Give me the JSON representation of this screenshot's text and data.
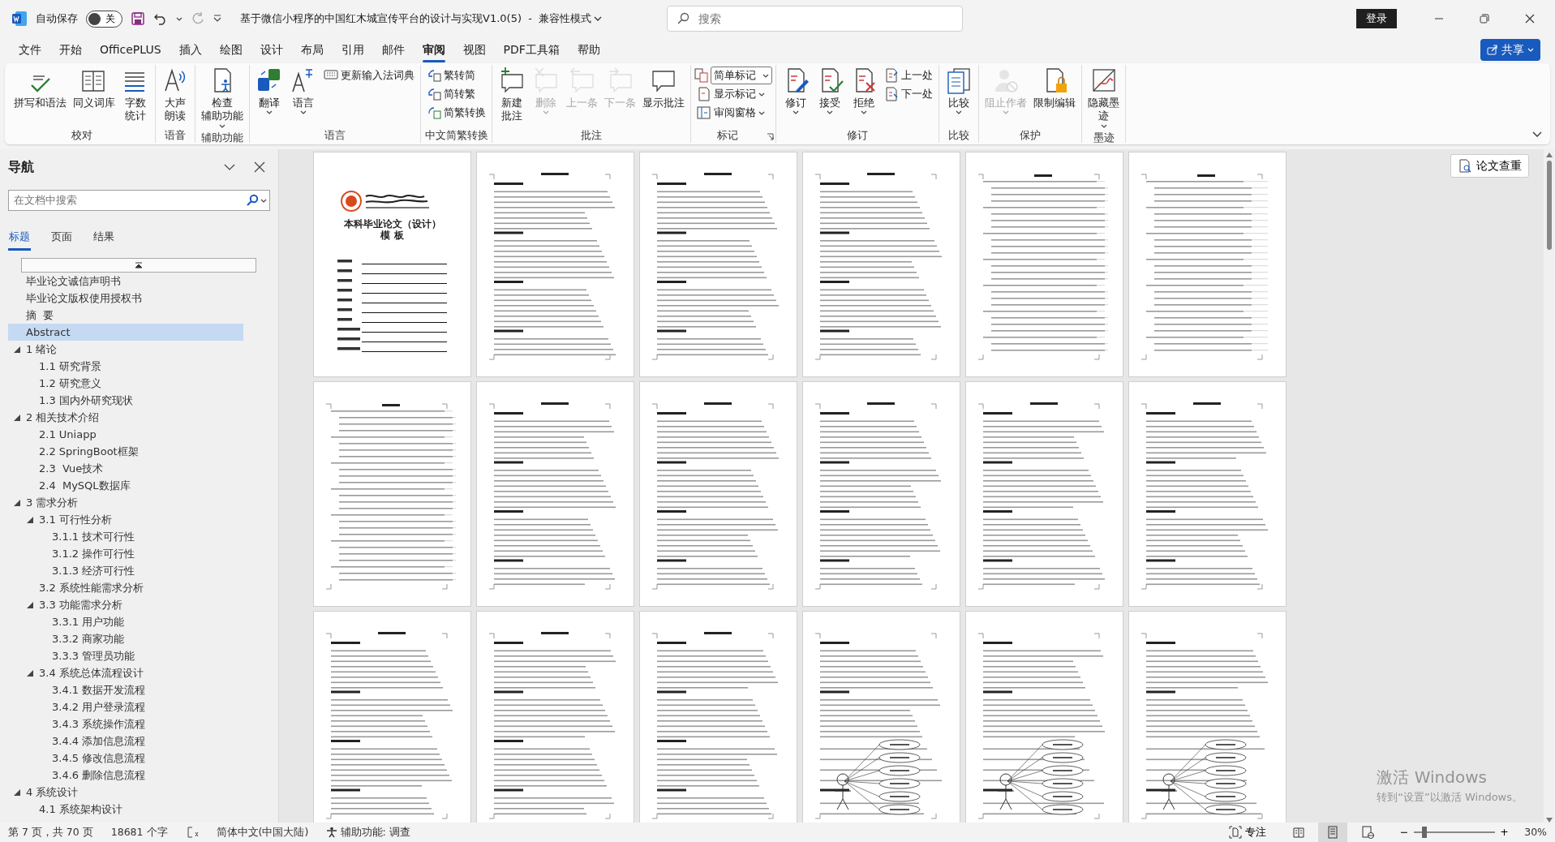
{
  "titlebar": {
    "autosave_label": "自动保存",
    "autosave_on": false,
    "autosave_state": "关",
    "title": "基于微信小程序的中国红木城宣传平台的设计与实现V1.0(5)  -  兼容性模式",
    "search_placeholder": "搜索",
    "login": "登录"
  },
  "menu_tabs": [
    {
      "label": "文件",
      "selected": false
    },
    {
      "label": "开始",
      "selected": false
    },
    {
      "label": "OfficePLUS",
      "selected": false
    },
    {
      "label": "插入",
      "selected": false
    },
    {
      "label": "绘图",
      "selected": false
    },
    {
      "label": "设计",
      "selected": false
    },
    {
      "label": "布局",
      "selected": false
    },
    {
      "label": "引用",
      "selected": false
    },
    {
      "label": "邮件",
      "selected": false
    },
    {
      "label": "审阅",
      "selected": true
    },
    {
      "label": "视图",
      "selected": false
    },
    {
      "label": "PDF工具箱",
      "selected": false
    },
    {
      "label": "帮助",
      "selected": false
    }
  ],
  "share": "共享",
  "ribbon_groups": [
    {
      "label": "校对",
      "launcher": false,
      "items": [
        {
          "kind": "large",
          "label": "拼写和语法",
          "caret": false,
          "disabled": false
        },
        {
          "kind": "large",
          "label": "同义词库",
          "caret": false,
          "disabled": false
        },
        {
          "kind": "large",
          "lines": [
            "字数",
            "统计"
          ],
          "caret": false,
          "disabled": false
        }
      ]
    },
    {
      "label": "语音",
      "launcher": false,
      "items": [
        {
          "kind": "large",
          "lines": [
            "大声",
            "朗读"
          ],
          "caret": false,
          "disabled": false
        }
      ]
    },
    {
      "label": "辅助功能",
      "launcher": false,
      "items": [
        {
          "kind": "large",
          "lines": [
            "检查",
            "辅助功能"
          ],
          "caret": true,
          "disabled": false
        }
      ]
    },
    {
      "label": "语言",
      "launcher": false,
      "items": [
        {
          "kind": "large",
          "label": "翻译",
          "caret": true,
          "disabled": false
        },
        {
          "kind": "large",
          "label": "语言",
          "caret": true,
          "disabled": false
        },
        {
          "kind": "small",
          "label": "更新输入法词典",
          "caret": false,
          "disabled": false
        }
      ]
    },
    {
      "label": "中文简繁转换",
      "launcher": false,
      "items": [
        {
          "kind": "small",
          "label": "繁转简",
          "caret": false,
          "disabled": false
        },
        {
          "kind": "small",
          "label": "简转繁",
          "caret": false,
          "disabled": false
        },
        {
          "kind": "small",
          "label": "简繁转换",
          "caret": false,
          "disabled": false
        }
      ]
    },
    {
      "label": "批注",
      "launcher": false,
      "items": [
        {
          "kind": "large",
          "lines": [
            "新建",
            "批注"
          ],
          "caret": false,
          "disabled": false
        },
        {
          "kind": "large",
          "label": "删除",
          "caret": true,
          "disabled": true
        },
        {
          "kind": "large",
          "label": "上一条",
          "caret": false,
          "disabled": true
        },
        {
          "kind": "large",
          "label": "下一条",
          "caret": false,
          "disabled": true
        },
        {
          "kind": "large",
          "label": "显示批注",
          "caret": false,
          "disabled": false
        }
      ]
    },
    {
      "label": "标记",
      "launcher": true,
      "items": [
        {
          "kind": "select",
          "label": "简单标记",
          "caret": true,
          "disabled": false
        },
        {
          "kind": "small",
          "label": "显示标记",
          "caret": true,
          "disabled": false
        },
        {
          "kind": "small",
          "label": "审阅窗格",
          "caret": true,
          "disabled": false
        }
      ]
    },
    {
      "label": "修订",
      "launcher": false,
      "items": [
        {
          "kind": "large",
          "label": "修订",
          "caret": true,
          "disabled": false
        },
        {
          "kind": "large",
          "label": "接受",
          "caret": true,
          "disabled": false
        },
        {
          "kind": "large",
          "label": "拒绝",
          "caret": true,
          "disabled": false
        },
        {
          "kind": "small",
          "label": "上一处",
          "caret": false,
          "disabled": false
        },
        {
          "kind": "small",
          "label": "下一处",
          "caret": false,
          "disabled": false
        }
      ]
    },
    {
      "label": "比较",
      "launcher": false,
      "items": [
        {
          "kind": "large",
          "label": "比较",
          "caret": true,
          "disabled": false
        }
      ]
    },
    {
      "label": "保护",
      "launcher": false,
      "items": [
        {
          "kind": "large",
          "label": "阻止作者",
          "caret": true,
          "disabled": true
        },
        {
          "kind": "large",
          "label": "限制编辑",
          "caret": false,
          "disabled": false
        }
      ]
    },
    {
      "label": "墨迹",
      "launcher": false,
      "items": [
        {
          "kind": "large",
          "lines": [
            "隐藏墨",
            "迹"
          ],
          "caret": true,
          "disabled": false
        }
      ]
    }
  ],
  "nav": {
    "title": "导航",
    "search_placeholder": "在文档中搜索",
    "tabs": [
      {
        "label": "标题",
        "selected": true
      },
      {
        "label": "页面",
        "selected": false
      },
      {
        "label": "结果",
        "selected": false
      }
    ],
    "headings": [
      {
        "label": "毕业论文诚信声明书",
        "selected": false
      },
      {
        "label": "毕业论文版权使用授权书",
        "selected": false
      },
      {
        "label": "摘  要",
        "selected": false
      },
      {
        "label": "Abstract",
        "selected": true
      },
      {
        "label": "1 绪论",
        "selected": false,
        "expanded": true,
        "children": [
          {
            "label": "1.1 研究背景",
            "selected": false
          },
          {
            "label": "1.2 研究意义",
            "selected": false
          },
          {
            "label": "1.3 国内外研究现状",
            "selected": false
          }
        ]
      },
      {
        "label": "2 相关技术介绍",
        "selected": false,
        "expanded": true,
        "children": [
          {
            "label": "2.1 Uniapp",
            "selected": false
          },
          {
            "label": "2.2 SpringBoot框架",
            "selected": false
          },
          {
            "label": "2.3  Vue技术",
            "selected": false
          },
          {
            "label": "2.4  MySQL数据库",
            "selected": false
          }
        ]
      },
      {
        "label": "3 需求分析",
        "selected": false,
        "expanded": true,
        "children": [
          {
            "label": "3.1 可行性分析",
            "selected": false,
            "expanded": true,
            "children": [
              {
                "label": "3.1.1 技术可行性",
                "selected": false
              },
              {
                "label": "3.1.2 操作可行性",
                "selected": false
              },
              {
                "label": "3.1.3 经济可行性",
                "selected": false
              }
            ]
          },
          {
            "label": "3.2 系统性能需求分析",
            "selected": false
          },
          {
            "label": "3.3 功能需求分析",
            "selected": false,
            "expanded": true,
            "children": [
              {
                "label": "3.3.1 用户功能",
                "selected": false
              },
              {
                "label": "3.3.2 商家功能",
                "selected": false
              },
              {
                "label": "3.3.3 管理员功能",
                "selected": false
              }
            ]
          },
          {
            "label": "3.4 系统总体流程设计",
            "selected": false,
            "expanded": true,
            "children": [
              {
                "label": "3.4.1 数据开发流程",
                "selected": false
              },
              {
                "label": "3.4.2 用户登录流程",
                "selected": false
              },
              {
                "label": "3.4.3 系统操作流程",
                "selected": false
              },
              {
                "label": "3.4.4 添加信息流程",
                "selected": false
              },
              {
                "label": "3.4.5 修改信息流程",
                "selected": false
              },
              {
                "label": "3.4.6 删除信息流程",
                "selected": false
              }
            ]
          }
        ]
      },
      {
        "label": "4 系统设计",
        "selected": false,
        "expanded": true,
        "children": [
          {
            "label": "4.1 系统架构设计",
            "selected": false
          }
        ]
      }
    ]
  },
  "pages": [
    {
      "kind": "cover",
      "title": "本科毕业论文（设计）",
      "subtitle": "模 板"
    },
    {
      "kind": "text"
    },
    {
      "kind": "text"
    },
    {
      "kind": "text"
    },
    {
      "kind": "toc"
    },
    {
      "kind": "toc"
    },
    {
      "kind": "toc"
    },
    {
      "kind": "text"
    },
    {
      "kind": "text"
    },
    {
      "kind": "text"
    },
    {
      "kind": "text"
    },
    {
      "kind": "text"
    },
    {
      "kind": "text"
    },
    {
      "kind": "text"
    },
    {
      "kind": "text"
    },
    {
      "kind": "diagram"
    },
    {
      "kind": "diagram"
    },
    {
      "kind": "diagram"
    }
  ],
  "check_button": "论文查重",
  "windows_notice": {
    "title": "激活 Windows",
    "text": "转到“设置”以激活 Windows。"
  },
  "status": {
    "page": "第 7 页，共 70 页",
    "words": "18681 个字",
    "language": "简体中文(中国大陆)",
    "accessibility": "辅助功能: 调查",
    "focus": "专注",
    "views": [
      {
        "selected": false
      },
      {
        "selected": true
      },
      {
        "selected": false
      }
    ],
    "zoom_minus": "−",
    "zoom_plus": "+",
    "zoom_slider": {
      "level": 0.13
    },
    "zoom": "30%"
  }
}
